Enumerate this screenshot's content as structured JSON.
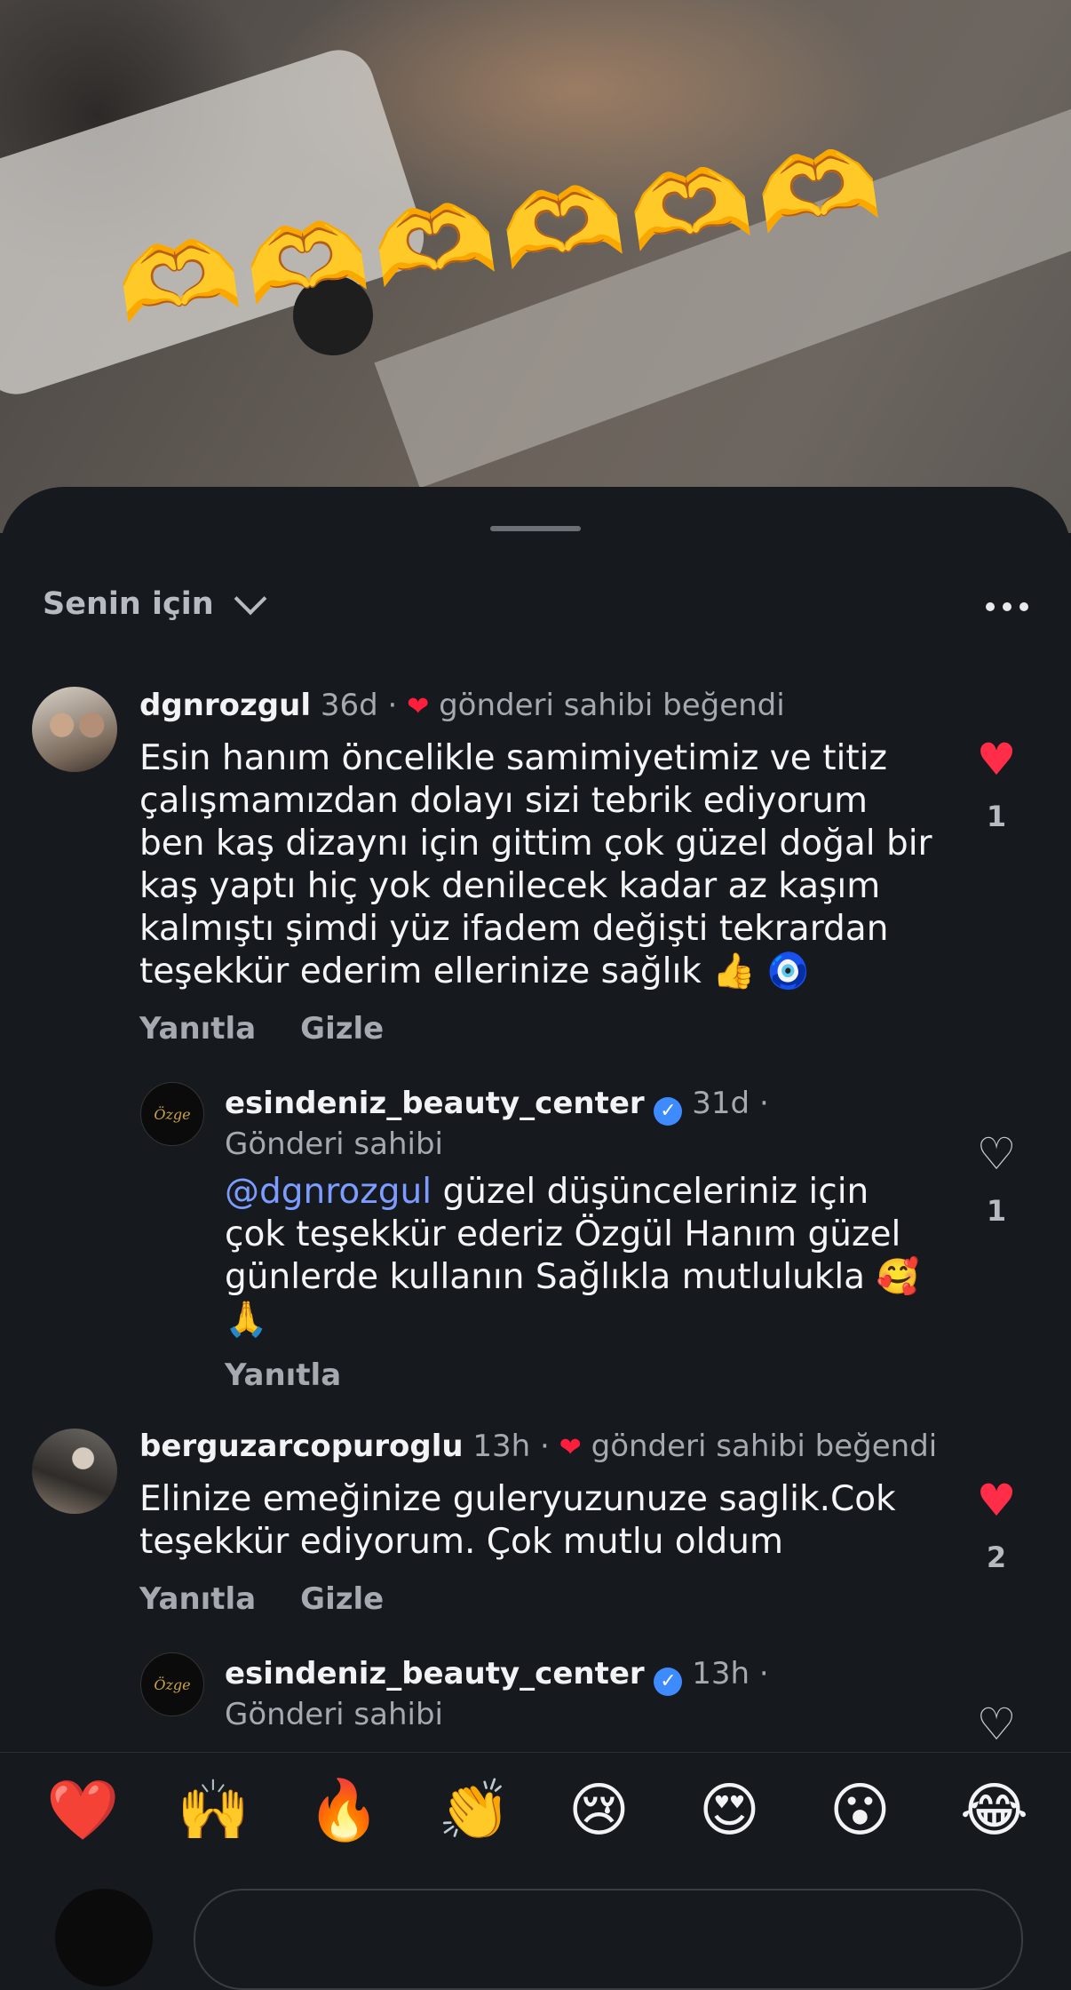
{
  "video": {
    "overlay_emojis": [
      "🫶",
      "🫶",
      "🫶",
      "🫶",
      "🫶",
      "🫶"
    ]
  },
  "sheet": {
    "filter_label": "Senin için"
  },
  "comments": [
    {
      "username": "dgnrozgul",
      "time": "36d",
      "separator": "·",
      "liked_by_author_text": "gönderi sahibi beğendi",
      "text": "Esin hanım öncelikle samimiyetimiz ve titiz çalışmamızdan dolayı sizi tebrik ediyorum ben kaş dizaynı için gittim çok güzel doğal bir kaş yaptı hiç yok denilecek kadar az kaşım kalmıştı şimdi yüz ifadem değişti tekrardan teşekkür ederim ellerinize sağlık 👍 🧿",
      "reply_label": "Yanıtla",
      "hide_label": "Gizle",
      "like_count": "1",
      "liked": true
    },
    {
      "username": "esindeniz_beauty_center",
      "time": "31d",
      "separator": "·",
      "owner_label": "Gönderi sahibi",
      "mention": "@dgnrozgul",
      "text": " güzel düşünceleriniz için çok teşekkür ederiz Özgül Hanım güzel günlerde kullanın Sağlıkla mutlulukla 🥰 🙏",
      "reply_label": "Yanıtla",
      "like_count": "1",
      "liked": false
    },
    {
      "username": "berguzarcopuroglu",
      "time": "13h",
      "separator": "·",
      "liked_by_author_text": "gönderi sahibi beğendi",
      "text": "Elinize emeğinize guleryuzunuze saglik.Cok teşekkür ediyorum. Çok mutlu oldum",
      "reply_label": "Yanıtla",
      "hide_label": "Gizle",
      "like_count": "2",
      "liked": true
    },
    {
      "username": "esindeniz_beauty_center",
      "time": "13h",
      "separator": "·",
      "owner_label": "Gönderi sahibi",
      "liked": false
    }
  ],
  "reactions": [
    "❤️",
    "🙌",
    "🔥",
    "👏",
    "😢",
    "😍",
    "😮",
    "😂"
  ],
  "icons": {
    "heart_filled_color": "#ff2d48",
    "verified_badge_color": "#3d8bff",
    "mention_color": "#7c9cff"
  }
}
